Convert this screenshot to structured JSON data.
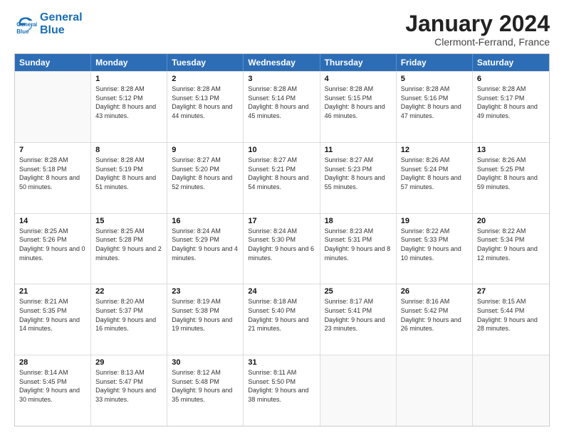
{
  "header": {
    "logo_line1": "General",
    "logo_line2": "Blue",
    "month_title": "January 2024",
    "location": "Clermont-Ferrand, France"
  },
  "days_of_week": [
    "Sunday",
    "Monday",
    "Tuesday",
    "Wednesday",
    "Thursday",
    "Friday",
    "Saturday"
  ],
  "weeks": [
    [
      {
        "day": "",
        "sunrise": "",
        "sunset": "",
        "daylight": ""
      },
      {
        "day": "1",
        "sunrise": "Sunrise: 8:28 AM",
        "sunset": "Sunset: 5:12 PM",
        "daylight": "Daylight: 8 hours and 43 minutes."
      },
      {
        "day": "2",
        "sunrise": "Sunrise: 8:28 AM",
        "sunset": "Sunset: 5:13 PM",
        "daylight": "Daylight: 8 hours and 44 minutes."
      },
      {
        "day": "3",
        "sunrise": "Sunrise: 8:28 AM",
        "sunset": "Sunset: 5:14 PM",
        "daylight": "Daylight: 8 hours and 45 minutes."
      },
      {
        "day": "4",
        "sunrise": "Sunrise: 8:28 AM",
        "sunset": "Sunset: 5:15 PM",
        "daylight": "Daylight: 8 hours and 46 minutes."
      },
      {
        "day": "5",
        "sunrise": "Sunrise: 8:28 AM",
        "sunset": "Sunset: 5:16 PM",
        "daylight": "Daylight: 8 hours and 47 minutes."
      },
      {
        "day": "6",
        "sunrise": "Sunrise: 8:28 AM",
        "sunset": "Sunset: 5:17 PM",
        "daylight": "Daylight: 8 hours and 49 minutes."
      }
    ],
    [
      {
        "day": "7",
        "sunrise": "Sunrise: 8:28 AM",
        "sunset": "Sunset: 5:18 PM",
        "daylight": "Daylight: 8 hours and 50 minutes."
      },
      {
        "day": "8",
        "sunrise": "Sunrise: 8:28 AM",
        "sunset": "Sunset: 5:19 PM",
        "daylight": "Daylight: 8 hours and 51 minutes."
      },
      {
        "day": "9",
        "sunrise": "Sunrise: 8:27 AM",
        "sunset": "Sunset: 5:20 PM",
        "daylight": "Daylight: 8 hours and 52 minutes."
      },
      {
        "day": "10",
        "sunrise": "Sunrise: 8:27 AM",
        "sunset": "Sunset: 5:21 PM",
        "daylight": "Daylight: 8 hours and 54 minutes."
      },
      {
        "day": "11",
        "sunrise": "Sunrise: 8:27 AM",
        "sunset": "Sunset: 5:23 PM",
        "daylight": "Daylight: 8 hours and 55 minutes."
      },
      {
        "day": "12",
        "sunrise": "Sunrise: 8:26 AM",
        "sunset": "Sunset: 5:24 PM",
        "daylight": "Daylight: 8 hours and 57 minutes."
      },
      {
        "day": "13",
        "sunrise": "Sunrise: 8:26 AM",
        "sunset": "Sunset: 5:25 PM",
        "daylight": "Daylight: 8 hours and 59 minutes."
      }
    ],
    [
      {
        "day": "14",
        "sunrise": "Sunrise: 8:25 AM",
        "sunset": "Sunset: 5:26 PM",
        "daylight": "Daylight: 9 hours and 0 minutes."
      },
      {
        "day": "15",
        "sunrise": "Sunrise: 8:25 AM",
        "sunset": "Sunset: 5:28 PM",
        "daylight": "Daylight: 9 hours and 2 minutes."
      },
      {
        "day": "16",
        "sunrise": "Sunrise: 8:24 AM",
        "sunset": "Sunset: 5:29 PM",
        "daylight": "Daylight: 9 hours and 4 minutes."
      },
      {
        "day": "17",
        "sunrise": "Sunrise: 8:24 AM",
        "sunset": "Sunset: 5:30 PM",
        "daylight": "Daylight: 9 hours and 6 minutes."
      },
      {
        "day": "18",
        "sunrise": "Sunrise: 8:23 AM",
        "sunset": "Sunset: 5:31 PM",
        "daylight": "Daylight: 9 hours and 8 minutes."
      },
      {
        "day": "19",
        "sunrise": "Sunrise: 8:22 AM",
        "sunset": "Sunset: 5:33 PM",
        "daylight": "Daylight: 9 hours and 10 minutes."
      },
      {
        "day": "20",
        "sunrise": "Sunrise: 8:22 AM",
        "sunset": "Sunset: 5:34 PM",
        "daylight": "Daylight: 9 hours and 12 minutes."
      }
    ],
    [
      {
        "day": "21",
        "sunrise": "Sunrise: 8:21 AM",
        "sunset": "Sunset: 5:35 PM",
        "daylight": "Daylight: 9 hours and 14 minutes."
      },
      {
        "day": "22",
        "sunrise": "Sunrise: 8:20 AM",
        "sunset": "Sunset: 5:37 PM",
        "daylight": "Daylight: 9 hours and 16 minutes."
      },
      {
        "day": "23",
        "sunrise": "Sunrise: 8:19 AM",
        "sunset": "Sunset: 5:38 PM",
        "daylight": "Daylight: 9 hours and 19 minutes."
      },
      {
        "day": "24",
        "sunrise": "Sunrise: 8:18 AM",
        "sunset": "Sunset: 5:40 PM",
        "daylight": "Daylight: 9 hours and 21 minutes."
      },
      {
        "day": "25",
        "sunrise": "Sunrise: 8:17 AM",
        "sunset": "Sunset: 5:41 PM",
        "daylight": "Daylight: 9 hours and 23 minutes."
      },
      {
        "day": "26",
        "sunrise": "Sunrise: 8:16 AM",
        "sunset": "Sunset: 5:42 PM",
        "daylight": "Daylight: 9 hours and 26 minutes."
      },
      {
        "day": "27",
        "sunrise": "Sunrise: 8:15 AM",
        "sunset": "Sunset: 5:44 PM",
        "daylight": "Daylight: 9 hours and 28 minutes."
      }
    ],
    [
      {
        "day": "28",
        "sunrise": "Sunrise: 8:14 AM",
        "sunset": "Sunset: 5:45 PM",
        "daylight": "Daylight: 9 hours and 30 minutes."
      },
      {
        "day": "29",
        "sunrise": "Sunrise: 8:13 AM",
        "sunset": "Sunset: 5:47 PM",
        "daylight": "Daylight: 9 hours and 33 minutes."
      },
      {
        "day": "30",
        "sunrise": "Sunrise: 8:12 AM",
        "sunset": "Sunset: 5:48 PM",
        "daylight": "Daylight: 9 hours and 35 minutes."
      },
      {
        "day": "31",
        "sunrise": "Sunrise: 8:11 AM",
        "sunset": "Sunset: 5:50 PM",
        "daylight": "Daylight: 9 hours and 38 minutes."
      },
      {
        "day": "",
        "sunrise": "",
        "sunset": "",
        "daylight": ""
      },
      {
        "day": "",
        "sunrise": "",
        "sunset": "",
        "daylight": ""
      },
      {
        "day": "",
        "sunrise": "",
        "sunset": "",
        "daylight": ""
      }
    ]
  ]
}
